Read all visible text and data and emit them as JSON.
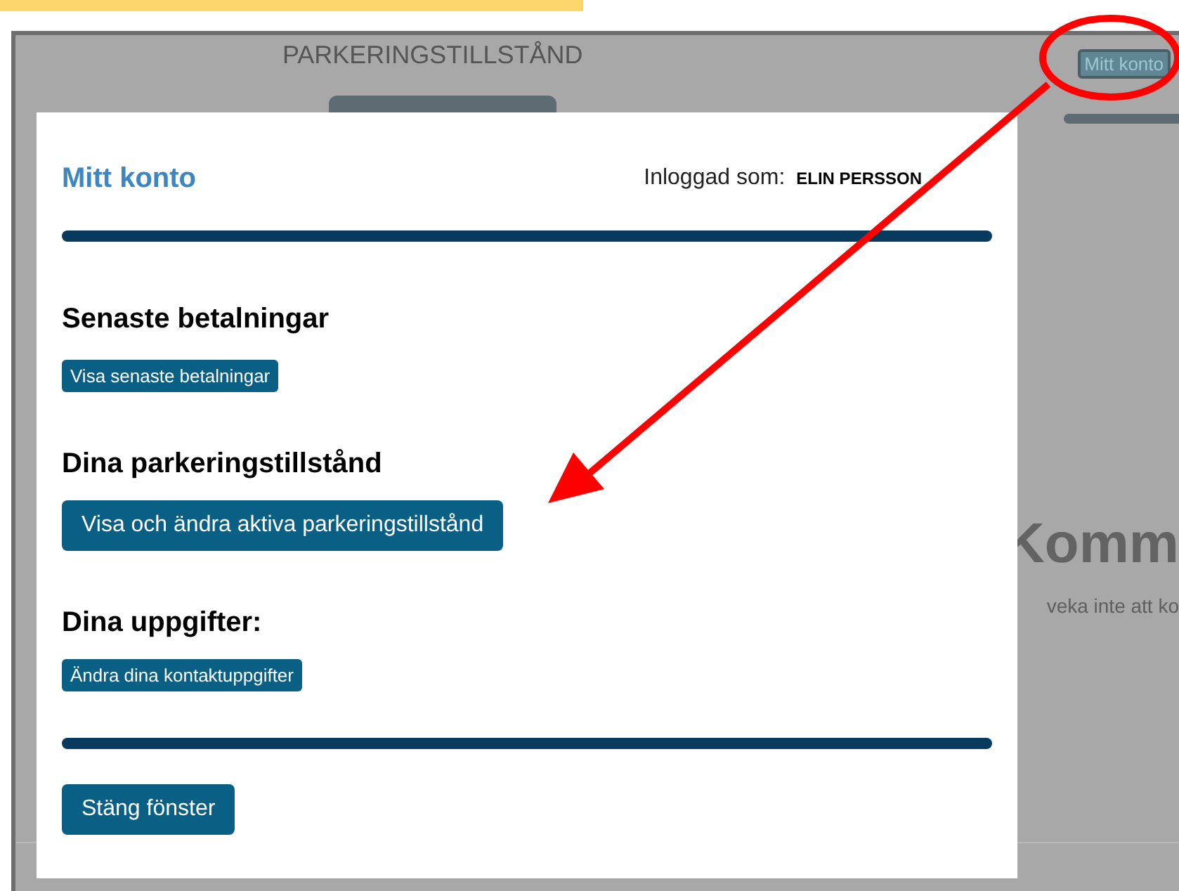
{
  "page": {
    "title": "PARKERINGSTILLSTÅND",
    "account_button": "Mitt konto",
    "right_fragments": [
      "Komm",
      "veka inte att ko"
    ]
  },
  "modal": {
    "title": "Mitt konto",
    "logged_in_label": "Inloggad som:",
    "user_name": "ELIN PERSSON",
    "sections": [
      {
        "heading": "Senaste betalningar",
        "button": "Visa senaste betalningar",
        "kind": "small"
      },
      {
        "heading": "Dina parkeringstillstånd",
        "button": "Visa och ändra aktiva parkeringstillstånd",
        "kind": "large"
      },
      {
        "heading": "Dina uppgifter:",
        "button": "Ändra dina kontaktuppgifter",
        "kind": "small"
      }
    ],
    "close_button": "Stäng fönster"
  }
}
